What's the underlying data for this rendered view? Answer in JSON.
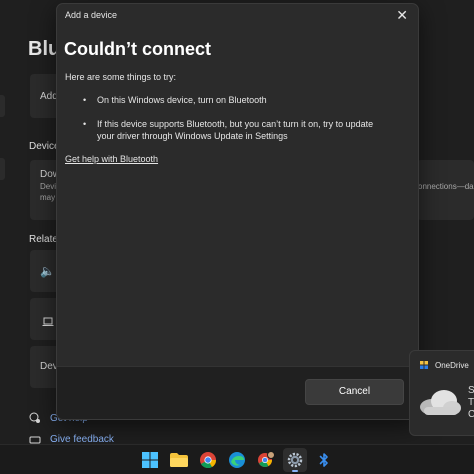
{
  "settings_bg": {
    "page_title": "Blue",
    "add_row_label": "Add",
    "devices_section": "Device",
    "device_row": {
      "name": "Dow",
      "desc1": "Devi",
      "desc2": "may",
      "right_text": "connections—da"
    },
    "related_section": "Related",
    "related_row_last": "Devi",
    "get_help_link": "Get help",
    "give_feedback_link": "Give feedback"
  },
  "dialog": {
    "window_title": "Add a device",
    "heading": "Couldn’t connect",
    "intro": "Here are some things to try:",
    "tips": [
      "On this Windows device, turn on Bluetooth",
      "If this device supports Bluetooth, but you can’t turn it on, try to update your driver through Windows Update in Settings"
    ],
    "help_link": "Get help with Bluetooth",
    "cancel_label": "Cancel",
    "close_glyph": "✕"
  },
  "toast": {
    "app_name": "OneDrive",
    "line1": "S",
    "line2": "T",
    "line3": "C"
  },
  "taskbar": {
    "items": [
      "windows-start",
      "file-explorer",
      "chrome",
      "edge",
      "chrome-profile",
      "settings",
      "bluetooth"
    ],
    "active": "settings"
  },
  "colors": {
    "accent": "#8ab4f8",
    "dialog_bg": "#2b2b2b",
    "footer_bg": "#202020",
    "page_bg": "#1f1f1f"
  }
}
